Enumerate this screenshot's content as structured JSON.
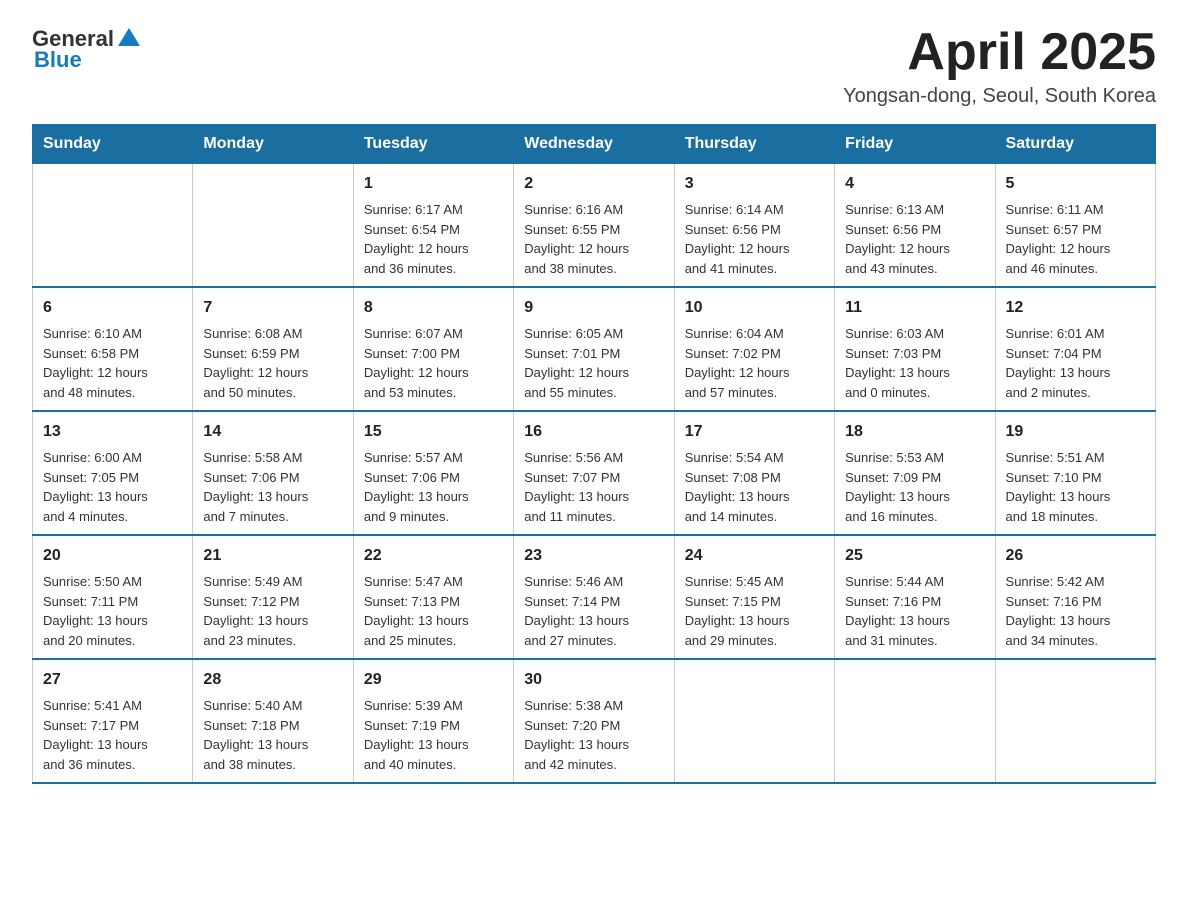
{
  "header": {
    "logo_general": "General",
    "logo_blue": "Blue",
    "month": "April 2025",
    "location": "Yongsan-dong, Seoul, South Korea"
  },
  "days_of_week": [
    "Sunday",
    "Monday",
    "Tuesday",
    "Wednesday",
    "Thursday",
    "Friday",
    "Saturday"
  ],
  "weeks": [
    [
      {
        "day": "",
        "info": ""
      },
      {
        "day": "",
        "info": ""
      },
      {
        "day": "1",
        "info": "Sunrise: 6:17 AM\nSunset: 6:54 PM\nDaylight: 12 hours\nand 36 minutes."
      },
      {
        "day": "2",
        "info": "Sunrise: 6:16 AM\nSunset: 6:55 PM\nDaylight: 12 hours\nand 38 minutes."
      },
      {
        "day": "3",
        "info": "Sunrise: 6:14 AM\nSunset: 6:56 PM\nDaylight: 12 hours\nand 41 minutes."
      },
      {
        "day": "4",
        "info": "Sunrise: 6:13 AM\nSunset: 6:56 PM\nDaylight: 12 hours\nand 43 minutes."
      },
      {
        "day": "5",
        "info": "Sunrise: 6:11 AM\nSunset: 6:57 PM\nDaylight: 12 hours\nand 46 minutes."
      }
    ],
    [
      {
        "day": "6",
        "info": "Sunrise: 6:10 AM\nSunset: 6:58 PM\nDaylight: 12 hours\nand 48 minutes."
      },
      {
        "day": "7",
        "info": "Sunrise: 6:08 AM\nSunset: 6:59 PM\nDaylight: 12 hours\nand 50 minutes."
      },
      {
        "day": "8",
        "info": "Sunrise: 6:07 AM\nSunset: 7:00 PM\nDaylight: 12 hours\nand 53 minutes."
      },
      {
        "day": "9",
        "info": "Sunrise: 6:05 AM\nSunset: 7:01 PM\nDaylight: 12 hours\nand 55 minutes."
      },
      {
        "day": "10",
        "info": "Sunrise: 6:04 AM\nSunset: 7:02 PM\nDaylight: 12 hours\nand 57 minutes."
      },
      {
        "day": "11",
        "info": "Sunrise: 6:03 AM\nSunset: 7:03 PM\nDaylight: 13 hours\nand 0 minutes."
      },
      {
        "day": "12",
        "info": "Sunrise: 6:01 AM\nSunset: 7:04 PM\nDaylight: 13 hours\nand 2 minutes."
      }
    ],
    [
      {
        "day": "13",
        "info": "Sunrise: 6:00 AM\nSunset: 7:05 PM\nDaylight: 13 hours\nand 4 minutes."
      },
      {
        "day": "14",
        "info": "Sunrise: 5:58 AM\nSunset: 7:06 PM\nDaylight: 13 hours\nand 7 minutes."
      },
      {
        "day": "15",
        "info": "Sunrise: 5:57 AM\nSunset: 7:06 PM\nDaylight: 13 hours\nand 9 minutes."
      },
      {
        "day": "16",
        "info": "Sunrise: 5:56 AM\nSunset: 7:07 PM\nDaylight: 13 hours\nand 11 minutes."
      },
      {
        "day": "17",
        "info": "Sunrise: 5:54 AM\nSunset: 7:08 PM\nDaylight: 13 hours\nand 14 minutes."
      },
      {
        "day": "18",
        "info": "Sunrise: 5:53 AM\nSunset: 7:09 PM\nDaylight: 13 hours\nand 16 minutes."
      },
      {
        "day": "19",
        "info": "Sunrise: 5:51 AM\nSunset: 7:10 PM\nDaylight: 13 hours\nand 18 minutes."
      }
    ],
    [
      {
        "day": "20",
        "info": "Sunrise: 5:50 AM\nSunset: 7:11 PM\nDaylight: 13 hours\nand 20 minutes."
      },
      {
        "day": "21",
        "info": "Sunrise: 5:49 AM\nSunset: 7:12 PM\nDaylight: 13 hours\nand 23 minutes."
      },
      {
        "day": "22",
        "info": "Sunrise: 5:47 AM\nSunset: 7:13 PM\nDaylight: 13 hours\nand 25 minutes."
      },
      {
        "day": "23",
        "info": "Sunrise: 5:46 AM\nSunset: 7:14 PM\nDaylight: 13 hours\nand 27 minutes."
      },
      {
        "day": "24",
        "info": "Sunrise: 5:45 AM\nSunset: 7:15 PM\nDaylight: 13 hours\nand 29 minutes."
      },
      {
        "day": "25",
        "info": "Sunrise: 5:44 AM\nSunset: 7:16 PM\nDaylight: 13 hours\nand 31 minutes."
      },
      {
        "day": "26",
        "info": "Sunrise: 5:42 AM\nSunset: 7:16 PM\nDaylight: 13 hours\nand 34 minutes."
      }
    ],
    [
      {
        "day": "27",
        "info": "Sunrise: 5:41 AM\nSunset: 7:17 PM\nDaylight: 13 hours\nand 36 minutes."
      },
      {
        "day": "28",
        "info": "Sunrise: 5:40 AM\nSunset: 7:18 PM\nDaylight: 13 hours\nand 38 minutes."
      },
      {
        "day": "29",
        "info": "Sunrise: 5:39 AM\nSunset: 7:19 PM\nDaylight: 13 hours\nand 40 minutes."
      },
      {
        "day": "30",
        "info": "Sunrise: 5:38 AM\nSunset: 7:20 PM\nDaylight: 13 hours\nand 42 minutes."
      },
      {
        "day": "",
        "info": ""
      },
      {
        "day": "",
        "info": ""
      },
      {
        "day": "",
        "info": ""
      }
    ]
  ]
}
